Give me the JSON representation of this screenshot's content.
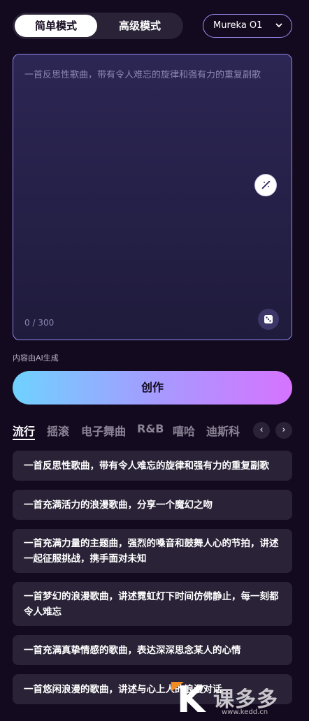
{
  "header": {
    "mode_simple": "简单模式",
    "mode_advanced": "高级模式",
    "model": "Mureka O1",
    "model_chevron": "⌄"
  },
  "prompt": {
    "placeholder": "一首反思性歌曲，带有令人难忘的旋律和强有力的重复副歌",
    "char_count": "0 / 300"
  },
  "ai_note": "内容由AI生成",
  "create_label": "创作",
  "tabs": [
    "流行",
    "摇滚",
    "电子舞曲",
    "R&B",
    "嘻哈",
    "迪斯科"
  ],
  "tab_nav": {
    "prev": "‹",
    "next": "›"
  },
  "suggestions": [
    "一首反思性歌曲，带有令人难忘的旋律和强有力的重复副歌",
    "一首充满活力的浪漫歌曲，分享一个魔幻之吻",
    "一首充满力量的主题曲，强烈的嗓音和鼓舞人心的节拍，讲述一起征服挑战，携手面对未知",
    "一首梦幻的浪漫歌曲，讲述霓虹灯下时间仿佛静止，每一刻都令人难忘",
    "一首充满真挚情感的歌曲，表达深深思念某人的心情",
    "一首悠闲浪漫的歌曲，讲述与心上人的浪漫对话"
  ],
  "watermark": {
    "letter": "K",
    "text": "课多多",
    "url": "www.kedd.cn"
  },
  "icons": {
    "magic": "magic-wand-icon",
    "dice": "dice-icon"
  },
  "colors": {
    "accent_start": "#6fd2ff",
    "accent_end": "#d673ff",
    "background": "#140a1f"
  }
}
